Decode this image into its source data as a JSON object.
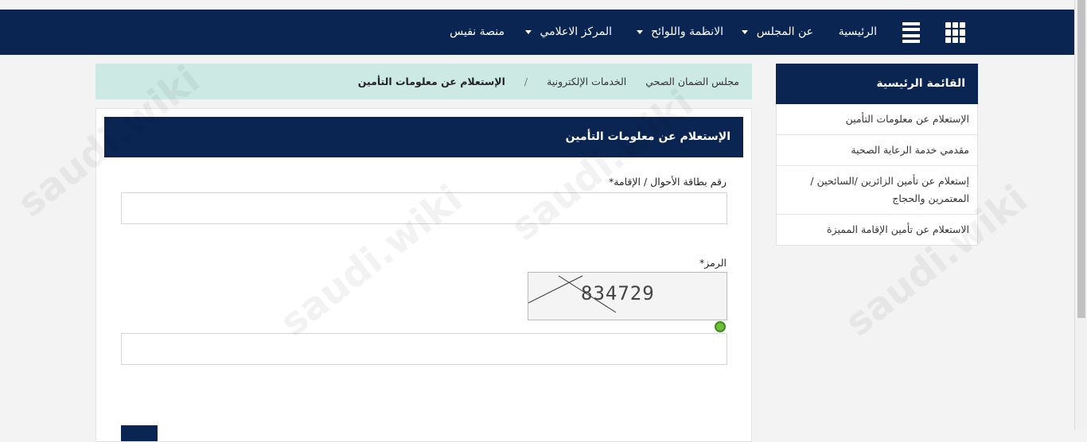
{
  "nav": {
    "items": [
      "الرئيسية",
      "عن المجلس",
      "الانظمة واللوائح",
      "المركز الاعلامي",
      "منصة نفيس"
    ],
    "grid_icon": "grid-icon",
    "list_icon": "list-icon"
  },
  "sidebar": {
    "title": "القائمة الرئيسية",
    "items": [
      "الإستعلام عن معلومات التأمين",
      "مقدمي خدمة الرعاية الصحية",
      "إستعلام عن تأمين الزائرين /السائحين / المعتمرين والحجاج",
      "الاستعلام عن تأمين الإقامة المميزة"
    ]
  },
  "breadcrumb": {
    "items": [
      "مجلس الضمان الصحي",
      "الخدمات الإلكترونية",
      "الإستعلام عن معلومات التأمين"
    ],
    "separator": "/"
  },
  "form": {
    "title": "الإستعلام عن معلومات التأمين",
    "id_label": "رقم بطاقة الأحوال / الإقامة*",
    "id_value": "",
    "code_label": "الرمز*",
    "captcha_text": "834729",
    "code_value": ""
  },
  "watermark": "saudi.wiki",
  "colors": {
    "navy": "#0b2553",
    "breadcrumb_bg": "#cde9e3"
  }
}
